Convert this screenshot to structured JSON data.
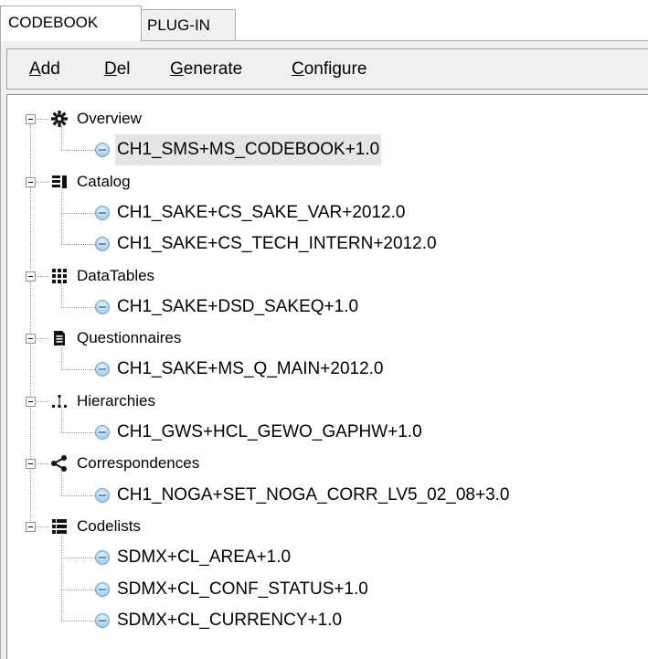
{
  "tabs": {
    "codebook": "CODEBOOK",
    "plugin": "PLUG-IN"
  },
  "menu": [
    {
      "key": "A",
      "rest": "dd"
    },
    {
      "key": "D",
      "rest": "el"
    },
    {
      "key": "G",
      "rest": "enerate"
    },
    {
      "key": "C",
      "rest": "onfigure"
    }
  ],
  "tree": [
    {
      "group": "Overview",
      "icon": "gear-icon",
      "items": [
        "CH1_SMS+MS_CODEBOOK+1.0"
      ]
    },
    {
      "group": "Catalog",
      "icon": "catalog-icon",
      "items": [
        "CH1_SAKE+CS_SAKE_VAR+2012.0",
        "CH1_SAKE+CS_TECH_INTERN+2012.0"
      ]
    },
    {
      "group": "DataTables",
      "icon": "grid-icon",
      "items": [
        "CH1_SAKE+DSD_SAKEQ+1.0"
      ]
    },
    {
      "group": "Questionnaires",
      "icon": "document-icon",
      "items": [
        "CH1_SAKE+MS_Q_MAIN+2012.0"
      ]
    },
    {
      "group": "Hierarchies",
      "icon": "hierarchy-icon",
      "items": [
        "CH1_GWS+HCL_GEWO_GAPHW+1.0"
      ]
    },
    {
      "group": "Correspondences",
      "icon": "share-icon",
      "items": [
        "CH1_NOGA+SET_NOGA_CORR_LV5_02_08+3.0"
      ]
    },
    {
      "group": "Codelists",
      "icon": "list-icon",
      "items": [
        "SDMX+CL_AREA+1.0",
        "SDMX+CL_CONF_STATUS+1.0",
        "SDMX+CL_CURRENCY+1.0"
      ]
    }
  ],
  "selected_item": "CH1_SMS+MS_CODEBOOK+1.0"
}
